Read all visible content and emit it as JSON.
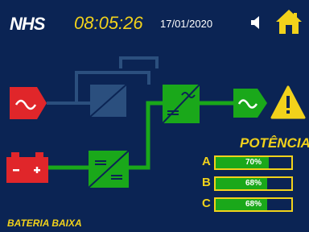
{
  "header": {
    "logo": "NHS",
    "time": "08:05:26",
    "date": "17/01/2020",
    "speaker_icon": "speaker-icon",
    "home_icon": "home-icon"
  },
  "diagram": {
    "input_icon": "ac-source-icon",
    "bypass_icon": "bypass-converter-icon",
    "output_inverter_icon": "dc-ac-inverter-icon",
    "output_icon": "ac-output-icon",
    "battery_icon": "battery-icon",
    "charger_icon": "dc-dc-converter-icon",
    "alert_icon": "warning-icon",
    "colors": {
      "active": "#1aa81a",
      "fault": "#e0262a",
      "inactive": "#2b4f7e",
      "accent": "#f2d21b"
    }
  },
  "power": {
    "title": "POTÊNCIA",
    "phases": [
      {
        "label": "A",
        "percent": 70,
        "text": "70%"
      },
      {
        "label": "B",
        "percent": 68,
        "text": "68%"
      },
      {
        "label": "C",
        "percent": 68,
        "text": "68%"
      }
    ]
  },
  "status": "BATERIA BAIXA"
}
